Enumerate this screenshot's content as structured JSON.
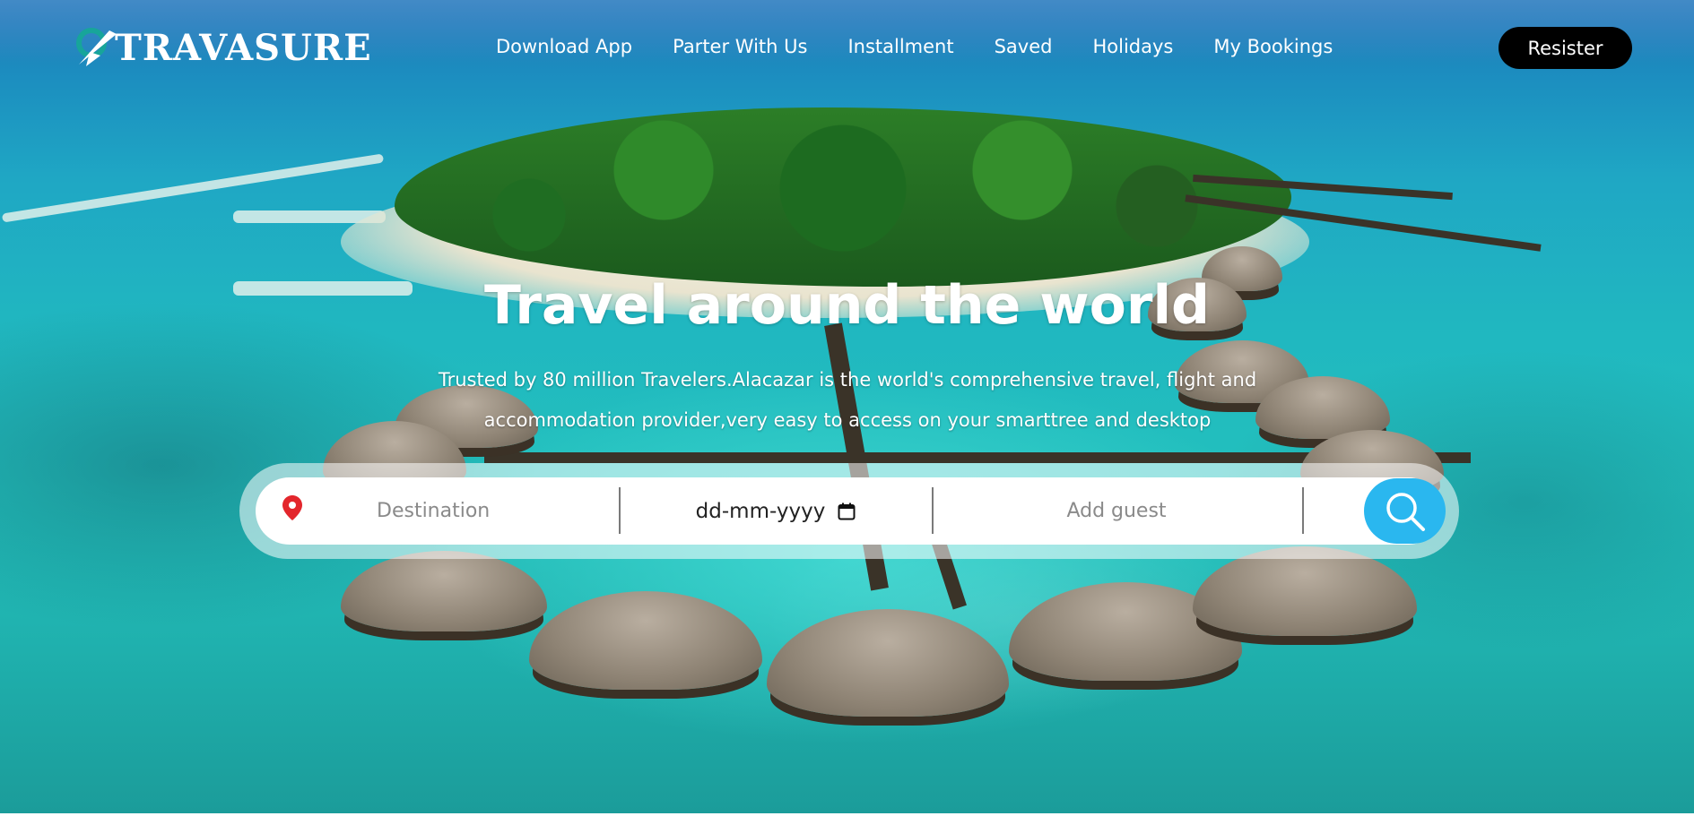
{
  "brand": {
    "name": "TRAVASURE"
  },
  "nav": {
    "items": [
      {
        "label": "Download App"
      },
      {
        "label": "Parter With Us"
      },
      {
        "label": "Installment"
      },
      {
        "label": "Saved"
      },
      {
        "label": "Holidays"
      },
      {
        "label": "My Bookings"
      }
    ],
    "register_label": "Resister"
  },
  "hero": {
    "title": "Travel around the world",
    "subtitle_line1": "Trusted by 80 million Travelers.Alacazar is the world's comprehensive travel, flight and",
    "subtitle_line2": "accommodation provider,very easy to access on your smarttree and desktop"
  },
  "search": {
    "destination_placeholder": "Destination",
    "date_value": "dd-mm-yyyy",
    "guest_placeholder": "Add guest"
  },
  "colors": {
    "accent": "#2ab7ef",
    "register_bg": "#000000",
    "pin": "#e3262c",
    "logo_teal": "#17a59a"
  },
  "icons": {
    "location": "map-pin-icon",
    "calendar": "calendar-icon",
    "search": "search-icon",
    "logo": "plane-globe-icon"
  }
}
